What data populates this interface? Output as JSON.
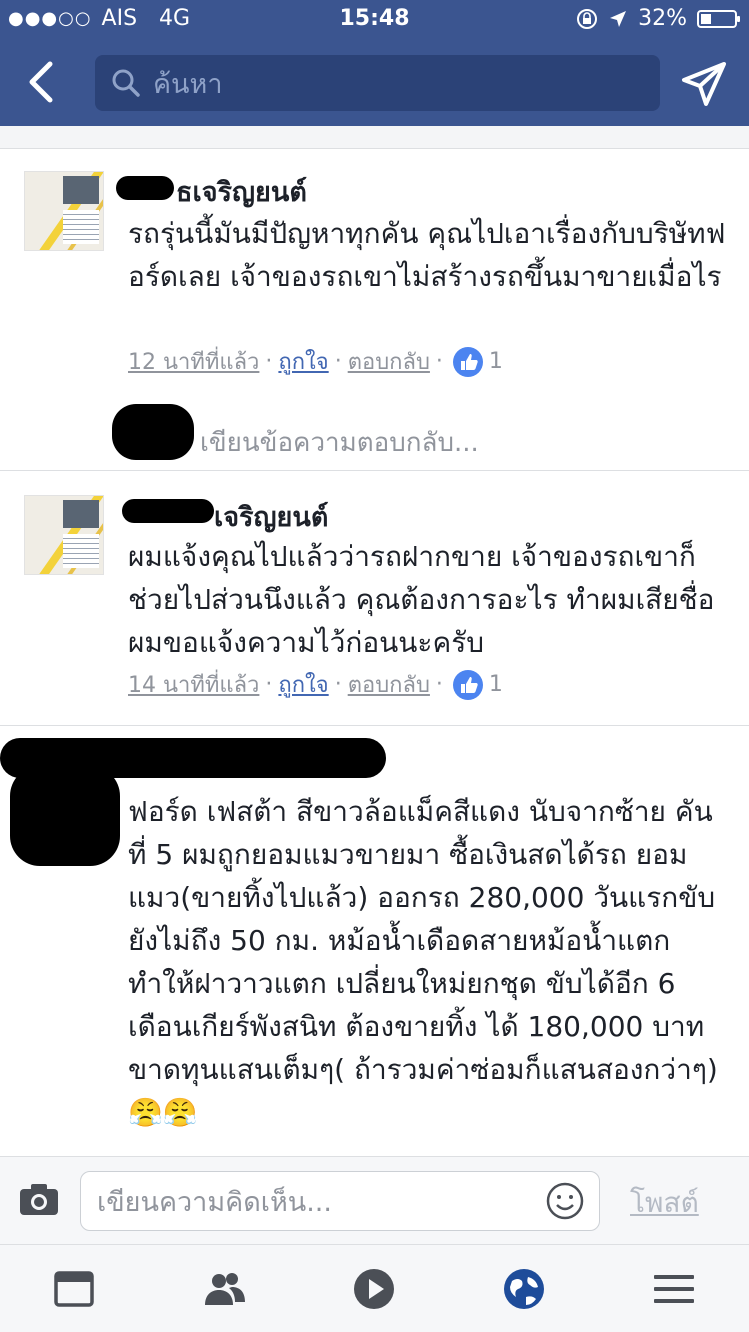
{
  "status_bar": {
    "carrier": "AIS",
    "network": "4G",
    "time": "15:48",
    "battery": "32%",
    "signal_dots": "●●●○○"
  },
  "nav": {
    "search_placeholder": "ค้นหา"
  },
  "comments": [
    {
      "author": "ธเจริญยนต์",
      "text": "รถรุ่นนี้มันมีปัญหาทุกคัน คุณไปเอาเรื่องกับบริษัทฟอร์ดเลย เจ้าของรถเขาไม่สร้างรถขึ้นมาขายเมื่อไร",
      "time": "12 นาทีที่แล้ว",
      "like_label": "ถูกใจ",
      "reply_label": "ตอบกลับ",
      "like_count": "1",
      "reply_prompt": "เขียนข้อความตอบกลับ..."
    },
    {
      "author": "เจริญยนต์",
      "text": "ผมแจ้งคุณไปแล้วว่ารถฝากขาย เจ้าของรถเขาก็ช่วยไปส่วนนึงแล้ว คุณต้องการอะไร ทำผมเสียชื่อผมขอแจ้งความไว้ก่อนนะครับ",
      "time": "14 นาทีที่แล้ว",
      "like_label": "ถูกใจ",
      "reply_label": "ตอบกลับ",
      "like_count": "1"
    },
    {
      "text": "ฟอร์ด เฟสต้า สีขาวล้อแม็คสีแดง นับจากซ้าย คันที่ 5 ผมถูกยอมแมวขายมา ซื้อเงินสดได้รถ ยอมแมว(ขายทิ้งไปแล้ว) ออกรถ 280,000 วันแรกขับยังไม่ถึง 50 กม. หม้อน้ำเดือดสายหม้อน้ำแตก ทำให้ฝาวาวแตก เปลี่ยนใหม่ยกชุด ขับได้อีก 6 เดือนเกียร์พังสนิท ต้องขายทิ้ง ได้ 180,000 บาท ขาดทุนแสนเต็มๆ( ถ้ารวมค่าซ่อมก็แสนสองกว่าๆ) 😤😤"
    }
  ],
  "composer": {
    "placeholder": "เขียนความคิดเห็น...",
    "post_label": "โพสต์"
  },
  "tabbar": {
    "icons": [
      "news-feed-icon",
      "friends-icon",
      "video-icon",
      "notifications-globe-icon",
      "menu-icon"
    ],
    "active_color": "#4267b2",
    "inactive_color": "#4b4f56"
  }
}
